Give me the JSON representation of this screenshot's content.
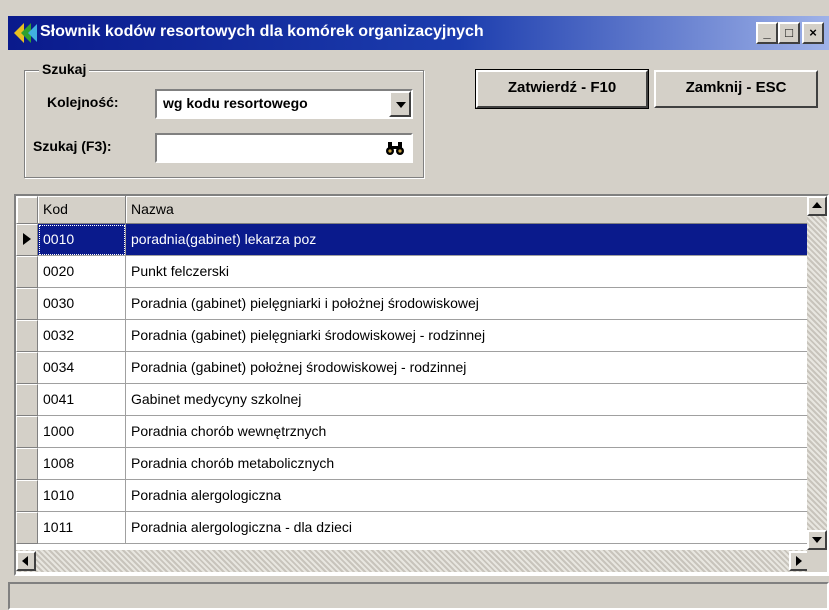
{
  "window": {
    "title": "Słownik kodów resortowych dla komórek organizacyjnych",
    "controls": {
      "minimize": "_",
      "maximize": "□",
      "close": "×"
    }
  },
  "search": {
    "group_label": "Szukaj",
    "order_label": "Kolejność:",
    "order_value": "wg kodu resortowego",
    "search_label": "Szukaj (F3):",
    "search_value": "",
    "search_icon": "binoculars-icon"
  },
  "actions": {
    "confirm_label": "Zatwierdź - F10",
    "close_label": "Zamknij - ESC"
  },
  "grid": {
    "columns": [
      "Kod",
      "Nazwa"
    ],
    "selected_index": 0,
    "rows": [
      {
        "kod": "0010",
        "nazwa": "poradnia(gabinet) lekarza poz"
      },
      {
        "kod": "0020",
        "nazwa": "Punkt felczerski"
      },
      {
        "kod": "0030",
        "nazwa": "Poradnia (gabinet) pielęgniarki i położnej środowiskowej"
      },
      {
        "kod": "0032",
        "nazwa": "Poradnia (gabinet) pielęgniarki środowiskowej - rodzinnej"
      },
      {
        "kod": "0034",
        "nazwa": "Poradnia (gabinet) położnej środowiskowej - rodzinnej"
      },
      {
        "kod": "0041",
        "nazwa": "Gabinet medycyny szkolnej"
      },
      {
        "kod": "1000",
        "nazwa": "Poradnia chorób wewnętrznych"
      },
      {
        "kod": "1008",
        "nazwa": "Poradnia chorób metabolicznych"
      },
      {
        "kod": "1010",
        "nazwa": "Poradnia alergologiczna"
      },
      {
        "kod": "1011",
        "nazwa": "Poradnia alergologiczna - dla dzieci"
      }
    ]
  },
  "colors": {
    "face": "#d4d0c8",
    "selection": "#0a1a8c",
    "title_start": "#0a1a8c",
    "title_end": "#9fb2e8"
  }
}
